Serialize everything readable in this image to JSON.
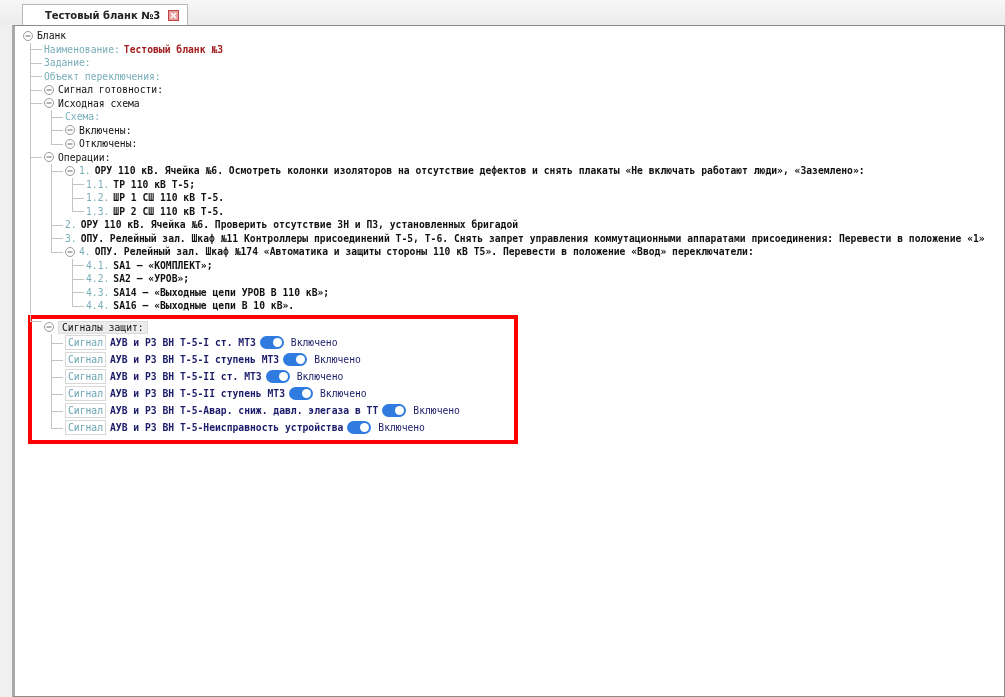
{
  "tab": {
    "title": "Тестовый бланк №3",
    "selected": true
  },
  "tree": [
    {
      "kind": "group",
      "label": "Бланк",
      "expanded": true,
      "selected": false,
      "children": [
        {
          "kind": "field",
          "label": "Наименование:",
          "value": "Тестовый бланк №3",
          "selected": false
        },
        {
          "kind": "field",
          "label": "Задание:",
          "selected": false
        },
        {
          "kind": "field",
          "label": "Объект переключения:",
          "selected": false
        },
        {
          "kind": "group",
          "label": "Сигнал готовности:",
          "expanded": true,
          "selected": false
        },
        {
          "kind": "group",
          "label": "Исходная схема",
          "expanded": true,
          "selected": false,
          "children": [
            {
              "kind": "field",
              "label": "Схема:",
              "selected": false
            },
            {
              "kind": "group",
              "label": "Включены:",
              "expanded": true,
              "selected": false
            },
            {
              "kind": "group",
              "label": "Отключены:",
              "expanded": true,
              "selected": false
            }
          ]
        },
        {
          "kind": "group",
          "label": "Операции:",
          "expanded": true,
          "selected": false,
          "children": [
            {
              "kind": "op",
              "number": "1.",
              "text": "ОРУ 110 кВ. Ячейка №6. Осмотреть колонки изоляторов на отсутствие дефектов и снять плакаты «Не включать работают люди», «Заземлено»:",
              "expanded": true,
              "selected": false,
              "children": [
                {
                  "kind": "op",
                  "number": "1.1.",
                  "text": "ТР 110 кВ Т-5;",
                  "selected": false
                },
                {
                  "kind": "op",
                  "number": "1.2.",
                  "text": "ШР 1 СШ 110 кВ Т-5.",
                  "selected": false
                },
                {
                  "kind": "op",
                  "number": "1.3.",
                  "text": "ШР 2 СШ 110 кВ Т-5.",
                  "selected": false
                }
              ]
            },
            {
              "kind": "op",
              "number": "2.",
              "text": "ОРУ 110 кВ. Ячейка №6. Проверить отсутствие ЗН и ПЗ, установленных бригадой",
              "selected": false
            },
            {
              "kind": "op",
              "number": "3.",
              "text": "ОПУ. Релейный зал. Шкаф №11 Контроллеры присоединений Т-5, Т-6. Снять запрет управления коммутационными аппаратами присоединения: Перевести в положение «1»",
              "selected": false
            },
            {
              "kind": "op",
              "number": "4.",
              "text": "ОПУ. Релейный зал. Шкаф №174 «Автоматика и защиты стороны 110 кВ Т5». Перевести в положение «Ввод» переключатели:",
              "expanded": true,
              "selected": false,
              "children": [
                {
                  "kind": "op",
                  "number": "4.1.",
                  "text": "SA1 – «КОМПЛЕКТ»;",
                  "selected": false
                },
                {
                  "kind": "op",
                  "number": "4.2.",
                  "text": "SA2 – «УРОВ»;",
                  "selected": false
                },
                {
                  "kind": "op",
                  "number": "4.3.",
                  "text": "SA14 – «Выходные цепи УРОВ В 110 кВ»;",
                  "selected": false
                },
                {
                  "kind": "op",
                  "number": "4.4.",
                  "text": "SA16 – «Выходные цепи В 10 кВ».",
                  "selected": false
                }
              ]
            }
          ]
        },
        {
          "kind": "group",
          "label": "Сигналы защит:",
          "expanded": true,
          "selected": true,
          "highlighted": true,
          "children": [
            {
              "kind": "signal",
              "tag": "Сигнал",
              "text": "АУВ и РЗ ВН Т-5-I ст. МТЗ",
              "on": true,
              "state": "Включено",
              "selected": false
            },
            {
              "kind": "signal",
              "tag": "Сигнал",
              "text": "АУВ и РЗ ВН Т-5-I ступень МТЗ",
              "on": true,
              "state": "Включено",
              "selected": false
            },
            {
              "kind": "signal",
              "tag": "Сигнал",
              "text": "АУВ и РЗ ВН Т-5-II ст. МТЗ",
              "on": true,
              "state": "Включено",
              "selected": false
            },
            {
              "kind": "signal",
              "tag": "Сигнал",
              "text": "АУВ и РЗ ВН Т-5-II ступень МТЗ",
              "on": true,
              "state": "Включено",
              "selected": false
            },
            {
              "kind": "signal",
              "tag": "Сигнал",
              "text": "АУВ и РЗ ВН Т-5-Авар. сниж. давл. элегаза в ТТ",
              "on": true,
              "state": "Включено",
              "selected": false
            },
            {
              "kind": "signal",
              "tag": "Сигнал",
              "text": "АУВ и РЗ ВН Т-5-Неисправность устройства",
              "on": true,
              "state": "Включено",
              "selected": false
            }
          ]
        }
      ]
    }
  ]
}
